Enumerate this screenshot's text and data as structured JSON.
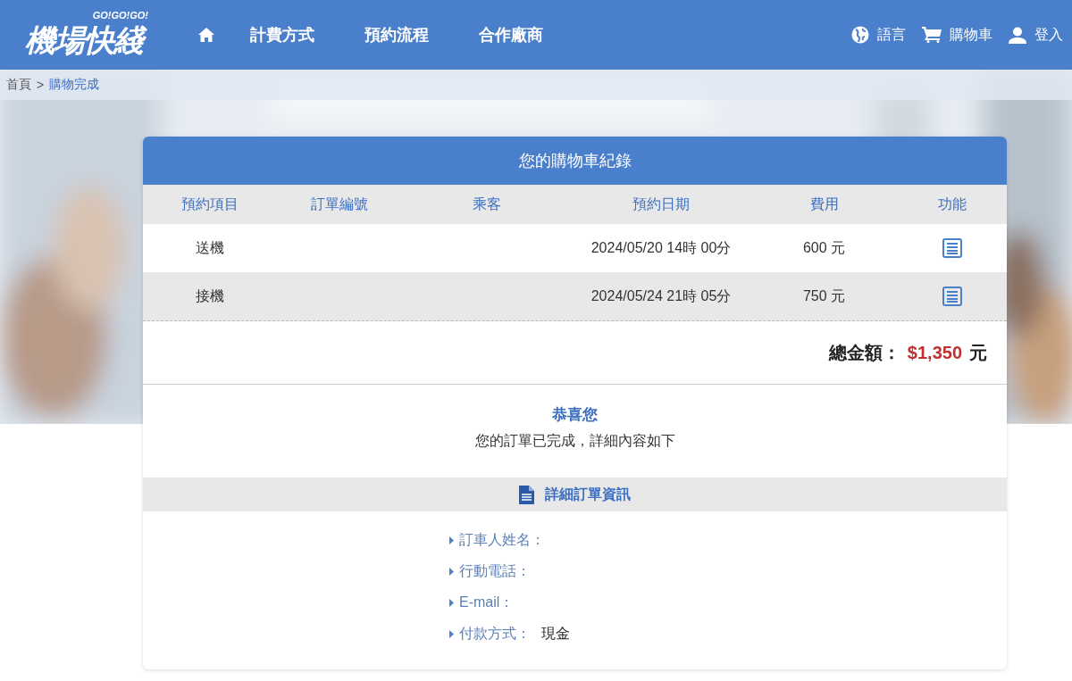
{
  "logo": {
    "text": "機場快綫",
    "tagline": "GO!GO!GO!"
  },
  "nav": [
    {
      "kind": "home"
    },
    {
      "kind": "text",
      "label": "計費方式"
    },
    {
      "kind": "text",
      "label": "預約流程"
    },
    {
      "kind": "text",
      "label": "合作廠商"
    }
  ],
  "nav_right": [
    {
      "kind": "globe",
      "label": "語言"
    },
    {
      "kind": "cart",
      "label": "購物車"
    },
    {
      "kind": "user",
      "label": "登入"
    }
  ],
  "breadcrumb": [
    {
      "label": "首頁",
      "current": false
    },
    {
      "label": "購物完成",
      "current": true
    }
  ],
  "breadcrumb_separator": ">",
  "cart": {
    "title": "您的購物車紀錄",
    "columns": [
      "預約項目",
      "訂單編號",
      "乘客",
      "預約日期",
      "費用",
      "功能"
    ],
    "rows": [
      {
        "item": "送機",
        "date": "2024/05/20 14時 00分",
        "fee": "600 元"
      },
      {
        "item": "接機",
        "date": "2024/05/24 21時 05分",
        "fee": "750 元"
      }
    ],
    "total_label": "總金額：",
    "total_amount": "$1,350",
    "total_unit": "元"
  },
  "message": {
    "title": "恭喜您",
    "text": "您的訂單已完成，詳細內容如下"
  },
  "details": {
    "title": "詳細訂單資訊",
    "fields": [
      {
        "label": "訂車人姓名："
      },
      {
        "label": "行動電話："
      },
      {
        "label": "E-mail："
      },
      {
        "label": "付款方式：",
        "value": "現金"
      }
    ]
  }
}
